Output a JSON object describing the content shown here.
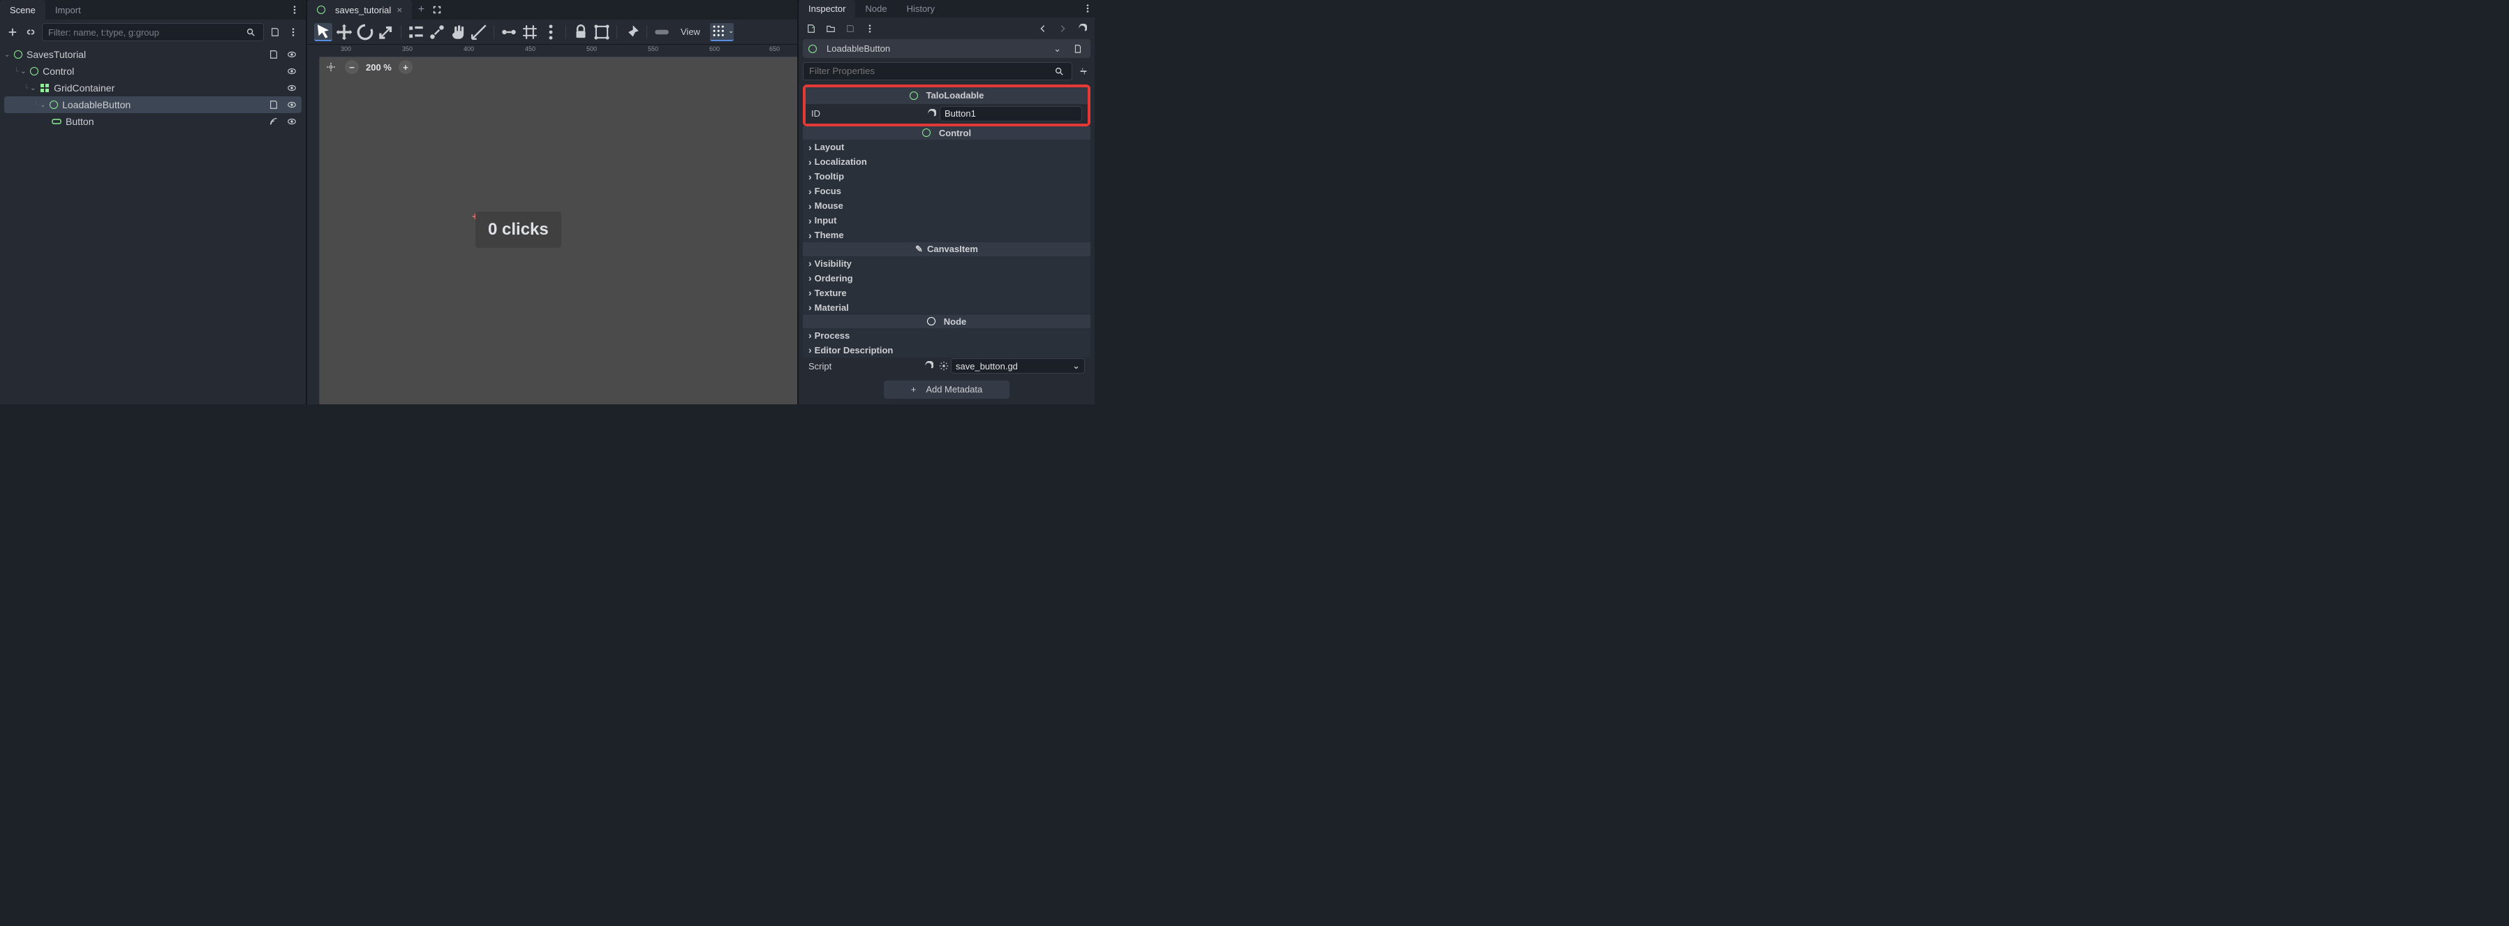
{
  "left": {
    "tabs": {
      "scene": "Scene",
      "import": "Import"
    },
    "filter_placeholder": "Filter: name, t:type, g:group",
    "tree": {
      "root": "SavesTutorial",
      "control": "Control",
      "grid": "GridContainer",
      "loadable": "LoadableButton",
      "button": "Button"
    }
  },
  "center": {
    "tab": "saves_tutorial",
    "zoom": "200 %",
    "clicks_label": "0 clicks",
    "view_label": "View",
    "ruler_marks": [
      "300",
      "350",
      "400",
      "450",
      "500",
      "550",
      "600",
      "650"
    ]
  },
  "right": {
    "tabs": {
      "inspector": "Inspector",
      "node": "Node",
      "history": "History"
    },
    "node_name": "LoadableButton",
    "filter_placeholder": "Filter Properties",
    "talo": {
      "header": "TaloLoadable",
      "id_label": "ID",
      "id_value": "Button1"
    },
    "control_header": "Control",
    "control_folds": [
      "Layout",
      "Localization",
      "Tooltip",
      "Focus",
      "Mouse",
      "Input",
      "Theme"
    ],
    "canvasitem_header": "CanvasItem",
    "canvas_folds": [
      "Visibility",
      "Ordering",
      "Texture",
      "Material"
    ],
    "node_header": "Node",
    "node_folds": [
      "Process",
      "Editor Description"
    ],
    "script_label": "Script",
    "script_value": "save_button.gd",
    "add_meta": "Add Metadata"
  }
}
